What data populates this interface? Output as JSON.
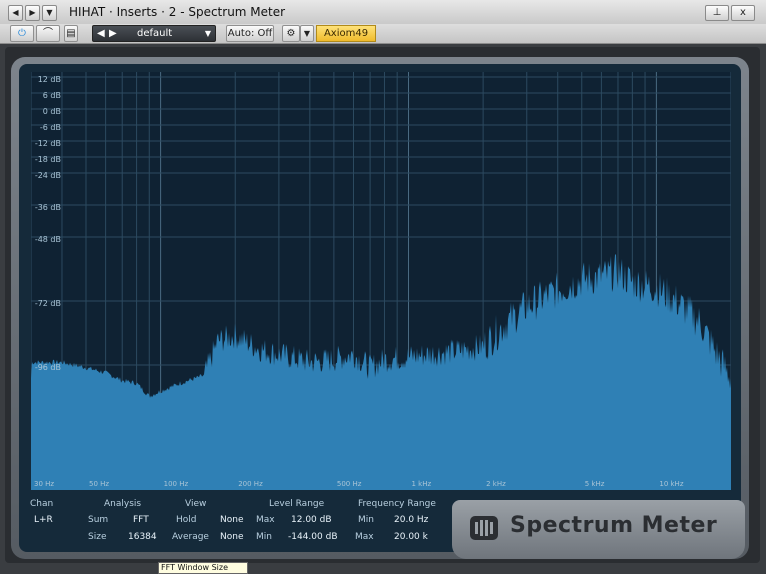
{
  "window": {
    "title": "HIHAT · Inserts · 2 - Spectrum Meter",
    "nav_prev": "◀",
    "nav_next": "▶",
    "nav_menu": "▼",
    "pin": "⊥",
    "close": "x"
  },
  "toolbar": {
    "power_icon": "⏻",
    "bypass_icon": "⌒",
    "preset_menu_icon": "▤",
    "preset_prev": "◀",
    "preset_next": "▶",
    "preset_name": "default",
    "preset_dropdown": "▼",
    "auto_label": "Auto: Off",
    "settings_icon": "⚙",
    "settings_dropdown": "▼",
    "device_label": "Axiom49"
  },
  "meter": {
    "ylabels": [
      "12 dB",
      "6 dB",
      "0 dB",
      "-6 dB",
      "-12 dB",
      "-18 dB",
      "-24 dB",
      "-36 dB",
      "-48 dB",
      "-72 dB",
      "-96 dB"
    ],
    "xlabels": [
      "30 Hz",
      "50 Hz",
      "100 Hz",
      "200 Hz",
      "500 Hz",
      "1 kHz",
      "2 kHz",
      "5 kHz",
      "10 kHz"
    ],
    "accent_color": "#2f80b5"
  },
  "chart_data": {
    "type": "area",
    "xscale": "log",
    "xlim": [
      30,
      20000
    ],
    "ylim": [
      -144,
      12
    ],
    "x": [
      30,
      40,
      50,
      60,
      70,
      80,
      90,
      100,
      120,
      150,
      170,
      200,
      250,
      300,
      400,
      500,
      600,
      700,
      800,
      1000,
      1200,
      1500,
      2000,
      2500,
      3000,
      4000,
      5000,
      6000,
      7000,
      8000,
      10000,
      12000,
      15000,
      18000,
      20000
    ],
    "values": [
      -95,
      -95,
      -97,
      -99,
      -102,
      -103,
      -108,
      -106,
      -103,
      -100,
      -87,
      -85,
      -90,
      -92,
      -95,
      -94,
      -92,
      -97,
      -94,
      -93,
      -92,
      -91,
      -89,
      -80,
      -74,
      -68,
      -64,
      -63,
      -61,
      -65,
      -67,
      -72,
      -80,
      -94,
      -101
    ]
  },
  "stats": {
    "chan_label": "Chan",
    "chan_value": "L+R",
    "analysis_label": "Analysis",
    "sum_label": "Sum",
    "sum_value": "FFT",
    "size_label": "Size",
    "size_value": "16384",
    "view_label": "View",
    "hold_label": "Hold",
    "hold_value": "None",
    "average_label": "Average",
    "average_value": "None",
    "level_range_label": "Level Range",
    "level_max_label": "Max",
    "level_max_value": "12.00 dB",
    "level_min_label": "Min",
    "level_min_value": "-144.00 dB",
    "freq_range_label": "Frequency Range",
    "freq_min_label": "Min",
    "freq_min_value": "20.0 Hz",
    "freq_max_label": "Max",
    "freq_max_value": "20.00 k"
  },
  "brand": {
    "name": "Spectrum Meter"
  },
  "tooltip": {
    "text": "FFT Window Size"
  }
}
